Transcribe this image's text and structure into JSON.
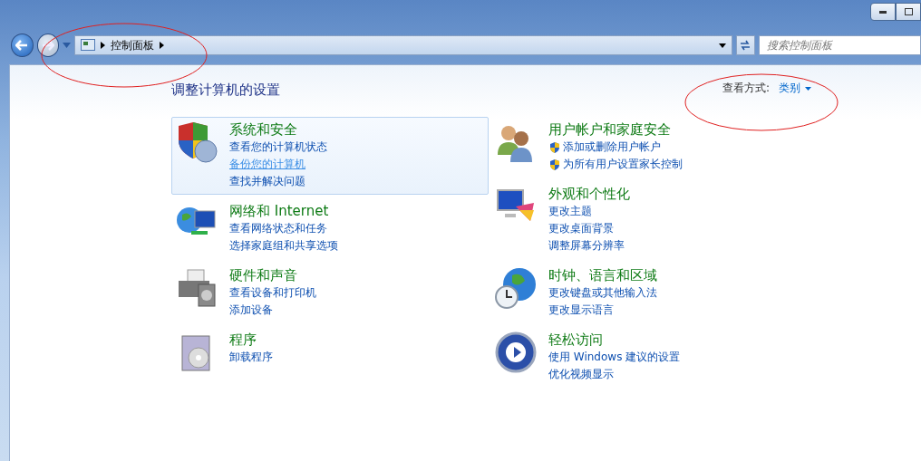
{
  "address_bar": {
    "crumbs": [
      "控制面板"
    ]
  },
  "search": {
    "placeholder": "搜索控制面板"
  },
  "heading": "调整计算机的设置",
  "view_by": {
    "label": "查看方式:",
    "value": "类别"
  },
  "columns": [
    {
      "categories": [
        {
          "title": "系统和安全",
          "hovered": true,
          "links": [
            {
              "text": "查看您的计算机状态",
              "kind": "plain",
              "hovered": false
            },
            {
              "text": "备份您的计算机",
              "kind": "plain",
              "hovered": true
            },
            {
              "text": "查找并解决问题",
              "kind": "plain",
              "hovered": false
            }
          ]
        },
        {
          "title": "网络和 Internet",
          "hovered": false,
          "links": [
            {
              "text": "查看网络状态和任务",
              "kind": "plain",
              "hovered": false
            },
            {
              "text": "选择家庭组和共享选项",
              "kind": "plain",
              "hovered": false
            }
          ]
        },
        {
          "title": "硬件和声音",
          "hovered": false,
          "links": [
            {
              "text": "查看设备和打印机",
              "kind": "plain",
              "hovered": false
            },
            {
              "text": "添加设备",
              "kind": "plain",
              "hovered": false
            }
          ]
        },
        {
          "title": "程序",
          "hovered": false,
          "links": [
            {
              "text": "卸载程序",
              "kind": "plain",
              "hovered": false
            }
          ]
        }
      ]
    },
    {
      "categories": [
        {
          "title": "用户帐户和家庭安全",
          "hovered": false,
          "links": [
            {
              "text": "添加或删除用户帐户",
              "kind": "admin",
              "hovered": false
            },
            {
              "text": "为所有用户设置家长控制",
              "kind": "admin",
              "hovered": false
            }
          ]
        },
        {
          "title": "外观和个性化",
          "hovered": false,
          "links": [
            {
              "text": "更改主题",
              "kind": "plain",
              "hovered": false
            },
            {
              "text": "更改桌面背景",
              "kind": "plain",
              "hovered": false
            },
            {
              "text": "调整屏幕分辨率",
              "kind": "plain",
              "hovered": false
            }
          ]
        },
        {
          "title": "时钟、语言和区域",
          "hovered": false,
          "links": [
            {
              "text": "更改键盘或其他输入法",
              "kind": "plain",
              "hovered": false
            },
            {
              "text": "更改显示语言",
              "kind": "plain",
              "hovered": false
            }
          ]
        },
        {
          "title": "轻松访问",
          "hovered": false,
          "links": [
            {
              "text": "使用 Windows 建议的设置",
              "kind": "plain",
              "hovered": false
            },
            {
              "text": "优化视频显示",
              "kind": "plain",
              "hovered": false
            }
          ]
        }
      ]
    }
  ]
}
